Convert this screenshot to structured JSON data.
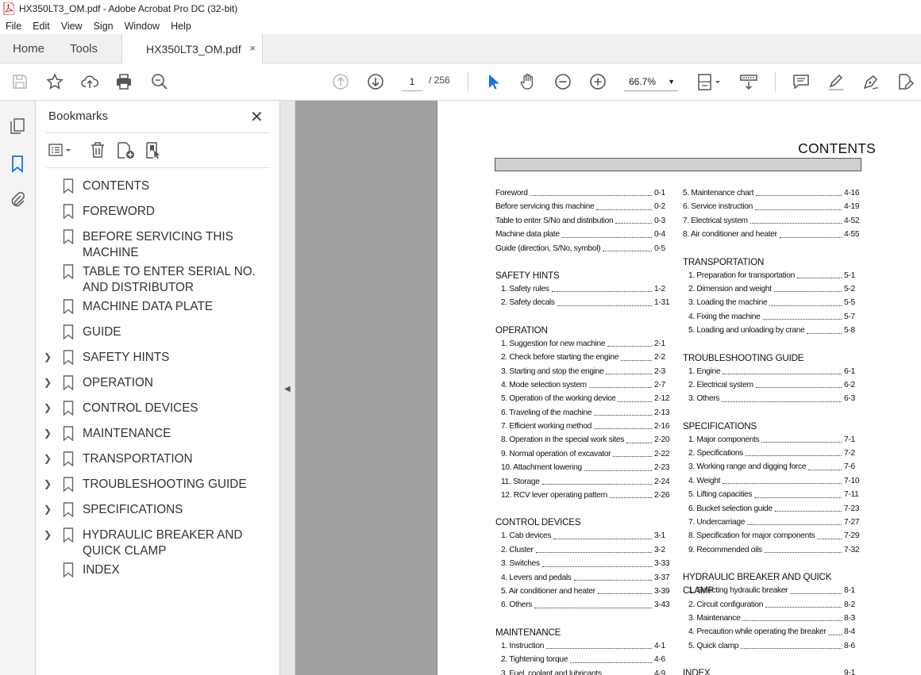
{
  "window": {
    "title": "HX350LT3_OM.pdf - Adobe Acrobat Pro DC (32-bit)"
  },
  "menu": [
    "File",
    "Edit",
    "View",
    "Sign",
    "Window",
    "Help"
  ],
  "tabs": {
    "home": "Home",
    "tools": "Tools",
    "document": "HX350LT3_OM.pdf",
    "close_glyph": "×"
  },
  "toolbar": {
    "page_current": "1",
    "page_sep": "/ 256",
    "zoom": "66.7%"
  },
  "bookmarks": {
    "title": "Bookmarks",
    "items": [
      {
        "label": "CONTENTS",
        "expandable": false
      },
      {
        "label": "FOREWORD",
        "expandable": false
      },
      {
        "label": "BEFORE SERVICING THIS MACHINE",
        "expandable": false
      },
      {
        "label": "TABLE TO ENTER SERIAL NO. AND DISTRIBUTOR",
        "expandable": false
      },
      {
        "label": "MACHINE DATA PLATE",
        "expandable": false
      },
      {
        "label": "GUIDE",
        "expandable": false
      },
      {
        "label": "SAFETY HINTS",
        "expandable": true
      },
      {
        "label": "OPERATION",
        "expandable": true
      },
      {
        "label": "CONTROL DEVICES",
        "expandable": true
      },
      {
        "label": "MAINTENANCE",
        "expandable": true
      },
      {
        "label": "TRANSPORTATION",
        "expandable": true
      },
      {
        "label": "TROUBLESHOOTING GUIDE",
        "expandable": true
      },
      {
        "label": "SPECIFICATIONS",
        "expandable": true
      },
      {
        "label": "HYDRAULIC BREAKER AND QUICK CLAMP",
        "expandable": true
      },
      {
        "label": "INDEX",
        "expandable": false
      }
    ]
  },
  "document": {
    "title": "CONTENTS",
    "left": [
      {
        "heading": "",
        "entries": [
          {
            "t": "Foreword",
            "p": "0-1"
          },
          {
            "t": "Before servicing this machine",
            "p": "0-2"
          },
          {
            "t": "Table to enter S/No and distribution",
            "p": "0-3"
          },
          {
            "t": "Machine data plate",
            "p": "0-4"
          },
          {
            "t": "Guide (direction, S/No, symbol)",
            "p": "0-5"
          }
        ]
      },
      {
        "heading": "SAFETY HINTS",
        "entries": [
          {
            "t": "1. Safety rules",
            "p": "1-2"
          },
          {
            "t": "2. Safety decals",
            "p": "1-31"
          }
        ]
      },
      {
        "heading": "OPERATION",
        "entries": [
          {
            "t": "1. Suggestion for new machine",
            "p": "2-1"
          },
          {
            "t": "2. Check before starting the engine",
            "p": "2-2"
          },
          {
            "t": "3. Starting and stop the engine",
            "p": "2-3"
          },
          {
            "t": "4. Mode selection system",
            "p": "2-7"
          },
          {
            "t": "5. Operation of the working device",
            "p": "2-12"
          },
          {
            "t": "6. Traveling of the machine",
            "p": "2-13"
          },
          {
            "t": "7. Efficient working method",
            "p": "2-16"
          },
          {
            "t": "8. Operation in the special work sites",
            "p": "2-20"
          },
          {
            "t": "9. Normal operation of excavator",
            "p": "2-22"
          },
          {
            "t": "10. Attachment lowering",
            "p": "2-23"
          },
          {
            "t": "11. Storage",
            "p": "2-24"
          },
          {
            "t": "12. RCV lever operating pattern",
            "p": "2-26"
          }
        ]
      },
      {
        "heading": "CONTROL DEVICES",
        "entries": [
          {
            "t": "1. Cab devices",
            "p": "3-1"
          },
          {
            "t": "2. Cluster",
            "p": "3-2"
          },
          {
            "t": "3. Switches",
            "p": "3-33"
          },
          {
            "t": "4. Levers and pedals",
            "p": "3-37"
          },
          {
            "t": "5. Air conditioner and heater",
            "p": "3-39"
          },
          {
            "t": "6. Others",
            "p": "3-43"
          }
        ]
      },
      {
        "heading": "MAINTENANCE",
        "entries": [
          {
            "t": "1. Instruction",
            "p": "4-1"
          },
          {
            "t": "2. Tightening torque",
            "p": "4-6"
          },
          {
            "t": "3. Fuel, coolant and lubricants",
            "p": "4-9"
          }
        ]
      }
    ],
    "right": [
      {
        "heading": "",
        "entries": [
          {
            "t": "5. Maintenance chart",
            "p": "4-16"
          },
          {
            "t": "6. Service instruction",
            "p": "4-19"
          },
          {
            "t": "7. Electrical system",
            "p": "4-52"
          },
          {
            "t": "8. Air conditioner and heater",
            "p": "4-55"
          }
        ]
      },
      {
        "heading": "TRANSPORTATION",
        "entries": [
          {
            "t": "1. Preparation for transportation",
            "p": "5-1"
          },
          {
            "t": "2. Dimension and weight",
            "p": "5-2"
          },
          {
            "t": "3. Loading the machine",
            "p": "5-5"
          },
          {
            "t": "4. Fixing the machine",
            "p": "5-7"
          },
          {
            "t": "5. Loading and unloading by crane",
            "p": "5-8"
          }
        ]
      },
      {
        "heading": "TROUBLESHOOTING GUIDE",
        "entries": [
          {
            "t": "1. Engine",
            "p": "6-1"
          },
          {
            "t": "2. Electrical system",
            "p": "6-2"
          },
          {
            "t": "3. Others",
            "p": "6-3"
          }
        ]
      },
      {
        "heading": "SPECIFICATIONS",
        "entries": [
          {
            "t": "1. Major components",
            "p": "7-1"
          },
          {
            "t": "2. Specifications",
            "p": "7-2"
          },
          {
            "t": "3. Working range and digging force",
            "p": "7-6"
          },
          {
            "t": "4. Weight",
            "p": "7-10"
          },
          {
            "t": "5. Lifting capacities",
            "p": "7-11"
          },
          {
            "t": "6. Bucket selection guide",
            "p": "7-23"
          },
          {
            "t": "7. Undercarriage",
            "p": "7-27"
          },
          {
            "t": "8. Specification for major components",
            "p": "7-29"
          },
          {
            "t": "9. Recommended oils",
            "p": "7-32"
          }
        ]
      },
      {
        "heading": "HYDRAULIC BREAKER AND QUICK CLAMP",
        "entries": [
          {
            "t": "1. Selecting hydraulic breaker",
            "p": "8-1"
          },
          {
            "t": "2. Circuit configuration",
            "p": "8-2"
          },
          {
            "t": "3. Maintenance",
            "p": "8-3"
          },
          {
            "t": "4. Precaution while operating the breaker",
            "p": "8-4"
          },
          {
            "t": "5. Quick clamp",
            "p": "8-6"
          }
        ]
      },
      {
        "heading": "INDEX",
        "heading_page": "9-1",
        "entries": []
      }
    ]
  },
  "colors": {
    "accent": "#1473e6",
    "pdf_red": "#d4372c",
    "viewer_bg": "#a0a0a0"
  }
}
